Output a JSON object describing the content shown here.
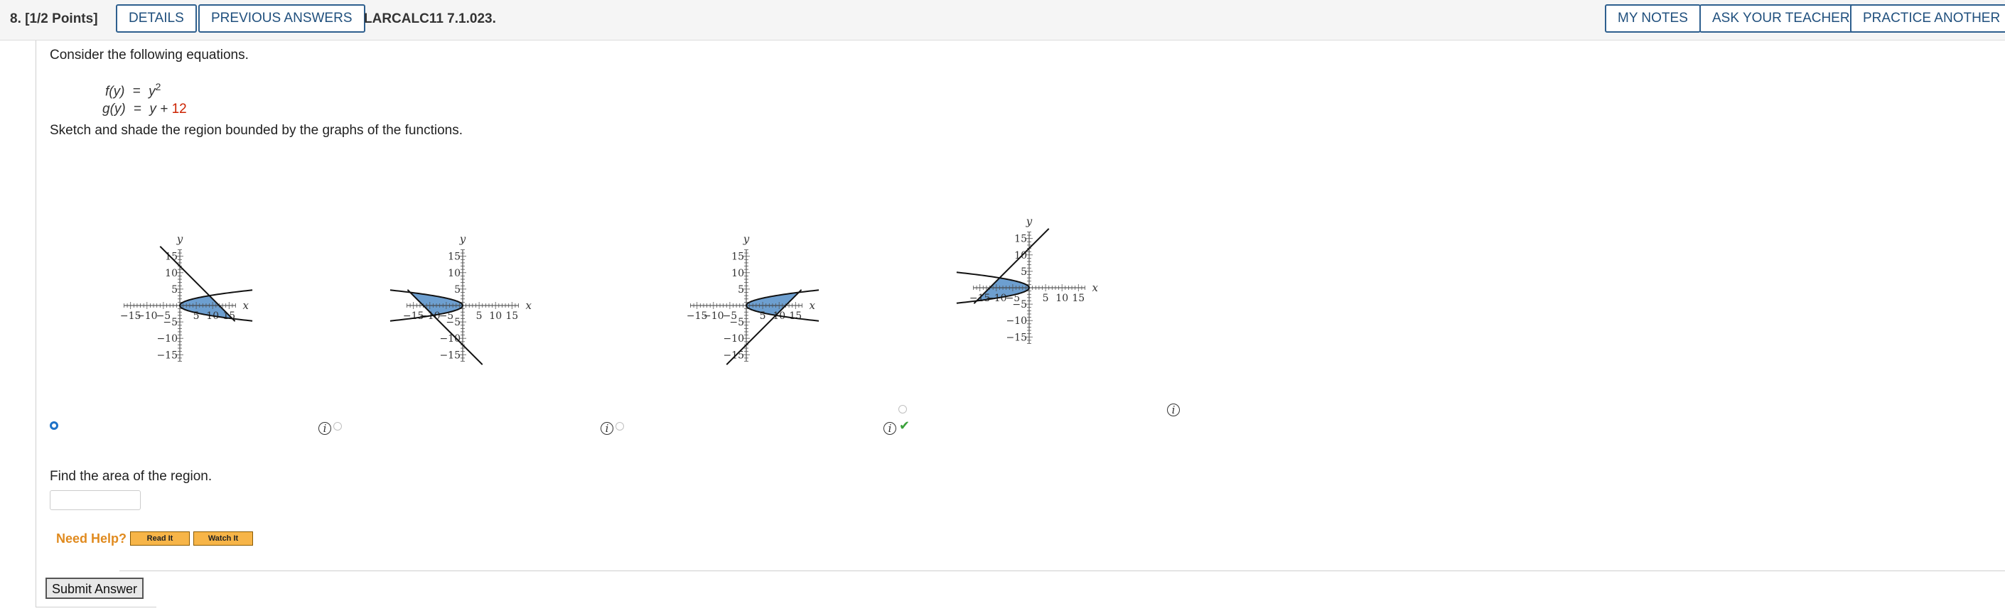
{
  "header": {
    "question_label": "8. [1/2 Points]",
    "details_label": "DETAILS",
    "previous_answers_label": "PREVIOUS ANSWERS",
    "problem_code": "LARCALC11 7.1.023.",
    "my_notes_label": "MY NOTES",
    "ask_teacher_label": "ASK YOUR TEACHER",
    "practice_another_label": "PRACTICE ANOTHER"
  },
  "question": {
    "intro": "Consider the following equations.",
    "eq1_lhs": "f(y)",
    "eq1_eq": "=",
    "eq1_rhs": "y",
    "eq1_exp": "2",
    "eq2_lhs": "g(y)",
    "eq2_eq": "=",
    "eq2_rhs": "y +",
    "eq2_const": "12",
    "instruction": "Sketch and shade the region bounded by the graphs of the functions.",
    "area_prompt": "Find the area of the region."
  },
  "graphs": {
    "axis_x_label": "x",
    "axis_y_label": "y",
    "tick_labels": [
      "−15",
      "−10",
      "−5",
      "5",
      "10",
      "15"
    ],
    "tick_values": [
      -15,
      -10,
      -5,
      5,
      10,
      15
    ],
    "shade_color": "#6d9fd0",
    "options": [
      {
        "selected": true,
        "correct": false
      },
      {
        "selected": false,
        "correct": false
      },
      {
        "selected": false,
        "correct": false
      },
      {
        "selected": false,
        "correct": true
      }
    ]
  },
  "help": {
    "label": "Need Help?",
    "read_it": "Read It",
    "watch_it": "Watch It"
  },
  "submit_label": "Submit Answer",
  "colors": {
    "button_border": "#2e5f8e",
    "radio_selected": "#1e72c8",
    "help_text": "#e08a1e",
    "help_button": "#f7b548",
    "eq_constant": "#cc2200",
    "checkmark": "#3aa13a"
  }
}
